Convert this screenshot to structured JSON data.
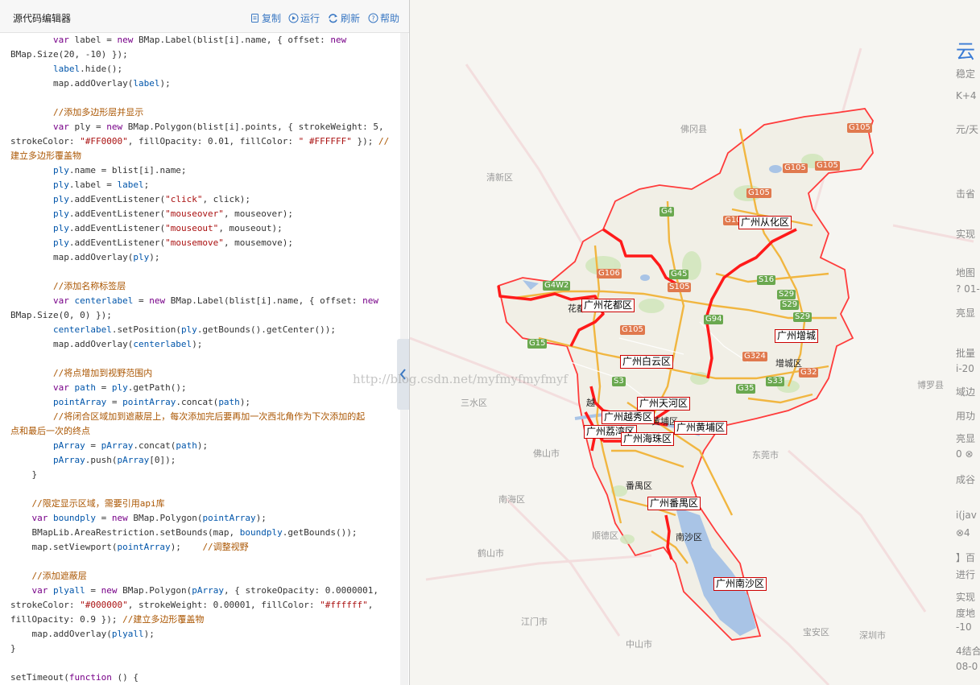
{
  "editor": {
    "title": "源代码编辑器",
    "toolbar": {
      "copy": "复制",
      "run": "运行",
      "refresh": "刷新",
      "help": "帮助"
    },
    "code_lines": [
      [
        [
          "w",
          "        "
        ],
        [
          "kw",
          "var "
        ],
        [
          "w",
          "label = "
        ],
        [
          "kw",
          "new "
        ],
        [
          "w",
          "BMap.Label(blist[i].name, { offset: "
        ],
        [
          "kw",
          "new"
        ]
      ],
      [
        [
          "w",
          "BMap.Size(20, -10) });"
        ]
      ],
      [
        [
          "w",
          "        "
        ],
        [
          "fn",
          "label"
        ],
        [
          "w",
          ".hide();"
        ]
      ],
      [
        [
          "w",
          "        map.addOverlay("
        ],
        [
          "fn",
          "label"
        ],
        [
          "w",
          ");"
        ]
      ],
      [
        [
          "w",
          ""
        ]
      ],
      [
        [
          "w",
          "        "
        ],
        [
          "cm",
          "//添加多边形层并显示"
        ]
      ],
      [
        [
          "w",
          "        "
        ],
        [
          "kw",
          "var "
        ],
        [
          "w",
          "ply = "
        ],
        [
          "kw",
          "new "
        ],
        [
          "w",
          "BMap.Polygon(blist[i].points, { strokeWeight: 5,"
        ]
      ],
      [
        [
          "w",
          "strokeColor: "
        ],
        [
          "str",
          "\"#FF0000\""
        ],
        [
          "w",
          ", fillOpacity: 0.01, fillColor: "
        ],
        [
          "str",
          "\" #FFFFFF\""
        ],
        [
          "w",
          " }); "
        ],
        [
          "cm",
          "//"
        ]
      ],
      [
        [
          "cm",
          "建立多边形覆盖物"
        ]
      ],
      [
        [
          "w",
          "        "
        ],
        [
          "fn",
          "ply"
        ],
        [
          "w",
          ".name = blist[i].name;"
        ]
      ],
      [
        [
          "w",
          "        "
        ],
        [
          "fn",
          "ply"
        ],
        [
          "w",
          ".label = "
        ],
        [
          "fn",
          "label"
        ],
        [
          "w",
          ";"
        ]
      ],
      [
        [
          "w",
          "        "
        ],
        [
          "fn",
          "ply"
        ],
        [
          "w",
          ".addEventListener("
        ],
        [
          "str",
          "\"click\""
        ],
        [
          "w",
          ", click);"
        ]
      ],
      [
        [
          "w",
          "        "
        ],
        [
          "fn",
          "ply"
        ],
        [
          "w",
          ".addEventListener("
        ],
        [
          "str",
          "\"mouseover\""
        ],
        [
          "w",
          ", mouseover);"
        ]
      ],
      [
        [
          "w",
          "        "
        ],
        [
          "fn",
          "ply"
        ],
        [
          "w",
          ".addEventListener("
        ],
        [
          "str",
          "\"mouseout\""
        ],
        [
          "w",
          ", mouseout);"
        ]
      ],
      [
        [
          "w",
          "        "
        ],
        [
          "fn",
          "ply"
        ],
        [
          "w",
          ".addEventListener("
        ],
        [
          "str",
          "\"mousemove\""
        ],
        [
          "w",
          ", mousemove);"
        ]
      ],
      [
        [
          "w",
          "        map.addOverlay("
        ],
        [
          "fn",
          "ply"
        ],
        [
          "w",
          ");"
        ]
      ],
      [
        [
          "w",
          ""
        ]
      ],
      [
        [
          "w",
          "        "
        ],
        [
          "cm",
          "//添加名称标签层"
        ]
      ],
      [
        [
          "w",
          "        "
        ],
        [
          "kw",
          "var "
        ],
        [
          "fn",
          "centerlabel"
        ],
        [
          "w",
          " = "
        ],
        [
          "kw",
          "new "
        ],
        [
          "w",
          "BMap.Label(blist[i].name, { offset: "
        ],
        [
          "kw",
          "new"
        ]
      ],
      [
        [
          "w",
          "BMap.Size(0, 0) });"
        ]
      ],
      [
        [
          "w",
          "        "
        ],
        [
          "fn",
          "centerlabel"
        ],
        [
          "w",
          ".setPosition("
        ],
        [
          "fn",
          "ply"
        ],
        [
          "w",
          ".getBounds().getCenter());"
        ]
      ],
      [
        [
          "w",
          "        map.addOverlay("
        ],
        [
          "fn",
          "centerlabel"
        ],
        [
          "w",
          ");"
        ]
      ],
      [
        [
          "w",
          ""
        ]
      ],
      [
        [
          "w",
          "        "
        ],
        [
          "cm",
          "//将点增加到视野范围内"
        ]
      ],
      [
        [
          "w",
          "        "
        ],
        [
          "kw",
          "var "
        ],
        [
          "fn",
          "path"
        ],
        [
          "w",
          " = "
        ],
        [
          "fn",
          "ply"
        ],
        [
          "w",
          ".getPath();"
        ]
      ],
      [
        [
          "w",
          "        "
        ],
        [
          "fn",
          "pointArray"
        ],
        [
          "w",
          " = "
        ],
        [
          "fn",
          "pointArray"
        ],
        [
          "w",
          ".concat("
        ],
        [
          "fn",
          "path"
        ],
        [
          "w",
          ");"
        ]
      ],
      [
        [
          "w",
          "        "
        ],
        [
          "cm",
          "//将闭合区域加到遮蔽层上，每次添加完后要再加一次西北角作为下次添加的起"
        ]
      ],
      [
        [
          "cm",
          "点和最后一次的终点"
        ]
      ],
      [
        [
          "w",
          "        "
        ],
        [
          "fn",
          "pArray"
        ],
        [
          "w",
          " = "
        ],
        [
          "fn",
          "pArray"
        ],
        [
          "w",
          ".concat("
        ],
        [
          "fn",
          "path"
        ],
        [
          "w",
          ");"
        ]
      ],
      [
        [
          "w",
          "        "
        ],
        [
          "fn",
          "pArray"
        ],
        [
          "w",
          ".push("
        ],
        [
          "fn",
          "pArray"
        ],
        [
          "w",
          "[0]);"
        ]
      ],
      [
        [
          "w",
          "    }"
        ]
      ],
      [
        [
          "w",
          ""
        ]
      ],
      [
        [
          "w",
          "    "
        ],
        [
          "cm",
          "//限定显示区域，需要引用api库"
        ]
      ],
      [
        [
          "w",
          "    "
        ],
        [
          "kw",
          "var "
        ],
        [
          "fn",
          "boundply"
        ],
        [
          "w",
          " = "
        ],
        [
          "kw",
          "new "
        ],
        [
          "w",
          "BMap.Polygon("
        ],
        [
          "fn",
          "pointArray"
        ],
        [
          "w",
          ");"
        ]
      ],
      [
        [
          "w",
          "    BMapLib.AreaRestriction.setBounds(map, "
        ],
        [
          "fn",
          "boundply"
        ],
        [
          "w",
          ".getBounds());"
        ]
      ],
      [
        [
          "w",
          "    map.setViewport("
        ],
        [
          "fn",
          "pointArray"
        ],
        [
          "w",
          ");    "
        ],
        [
          "cm",
          "//调整视野"
        ]
      ],
      [
        [
          "w",
          ""
        ]
      ],
      [
        [
          "w",
          "    "
        ],
        [
          "cm",
          "//添加遮蔽层"
        ]
      ],
      [
        [
          "w",
          "    "
        ],
        [
          "kw",
          "var "
        ],
        [
          "fn",
          "plyall"
        ],
        [
          "w",
          " = "
        ],
        [
          "kw",
          "new "
        ],
        [
          "w",
          "BMap.Polygon("
        ],
        [
          "fn",
          "pArray"
        ],
        [
          "w",
          ", { strokeOpacity: 0.0000001,"
        ]
      ],
      [
        [
          "w",
          "strokeColor: "
        ],
        [
          "str",
          "\"#000000\""
        ],
        [
          "w",
          ", strokeWeight: 0.00001, fillColor: "
        ],
        [
          "str",
          "\"#ffffff\""
        ],
        [
          "w",
          ","
        ]
      ],
      [
        [
          "w",
          "fillOpacity: 0.9 }); "
        ],
        [
          "cm",
          "//建立多边形覆盖物"
        ]
      ],
      [
        [
          "w",
          "    map.addOverlay("
        ],
        [
          "fn",
          "plyall"
        ],
        [
          "w",
          ");"
        ]
      ],
      [
        [
          "w",
          "}"
        ]
      ],
      [
        [
          "w",
          ""
        ]
      ],
      [
        [
          "w",
          "setTimeout("
        ],
        [
          "kw",
          "function "
        ],
        [
          "w",
          "() {"
        ]
      ]
    ]
  },
  "map": {
    "watermark": "http://blog.csdn.net/myfmyfmyfmyf",
    "district_labels": [
      {
        "id": "conghua",
        "text": "广州从化区"
      },
      {
        "id": "huadu",
        "text": "广州花都区"
      },
      {
        "id": "zengcheng",
        "text": "广州增城"
      },
      {
        "id": "baiyun",
        "text": "广州白云区"
      },
      {
        "id": "tianhe",
        "text": "广州天河区"
      },
      {
        "id": "yuexiu",
        "text": "广州越秀区"
      },
      {
        "id": "huangpu",
        "text": "广州黄埔区"
      },
      {
        "id": "liwan",
        "text": "广州荔湾区"
      },
      {
        "id": "haizhu",
        "text": "广州海珠区"
      },
      {
        "id": "panyu",
        "text": "广州番禺区"
      },
      {
        "id": "nansha",
        "text": "广州南沙区"
      }
    ],
    "place_names": [
      {
        "id": "huadu-short",
        "text": "花都"
      },
      {
        "id": "zengcheng-qu",
        "text": "增城区"
      },
      {
        "id": "panyu-qu",
        "text": "番禺区"
      },
      {
        "id": "nansha-qu",
        "text": "南沙区"
      },
      {
        "id": "huangpu-qu",
        "text": "黄埔区"
      },
      {
        "id": "yuexiu-short",
        "text": "越"
      }
    ],
    "faint_places": [
      {
        "id": "foshan",
        "text": "佛山市"
      },
      {
        "id": "dongguan",
        "text": "东莞市"
      },
      {
        "id": "jiangmen",
        "text": "江门市"
      },
      {
        "id": "zhongshan",
        "text": "中山市"
      },
      {
        "id": "shenzhen",
        "text": "深圳市"
      },
      {
        "id": "sanshui",
        "text": "三水区"
      },
      {
        "id": "nanhai",
        "text": "南海区"
      },
      {
        "id": "shunde",
        "text": "顺德区"
      },
      {
        "id": "heshan",
        "text": "鹤山市"
      },
      {
        "id": "qingxin",
        "text": "清新区"
      },
      {
        "id": "fogang",
        "text": "佛冈县"
      },
      {
        "id": "baoan",
        "text": "宝安区"
      },
      {
        "id": "boluo",
        "text": "博罗县"
      }
    ],
    "road_shields": [
      {
        "id": "g105a",
        "text": "G105",
        "kind": "g"
      },
      {
        "id": "g105b",
        "text": "G105",
        "kind": "g"
      },
      {
        "id": "g105c",
        "text": "G105",
        "kind": "g"
      },
      {
        "id": "g105d",
        "text": "G105",
        "kind": "g"
      },
      {
        "id": "g105e",
        "text": "G105",
        "kind": "g"
      },
      {
        "id": "g106",
        "text": "G106",
        "kind": "g"
      },
      {
        "id": "g106b",
        "text": "G106",
        "kind": "g"
      },
      {
        "id": "g45",
        "text": "G45",
        "kind": "s"
      },
      {
        "id": "s105",
        "text": "S105",
        "kind": "g"
      },
      {
        "id": "g4w2",
        "text": "G4W2",
        "kind": "s"
      },
      {
        "id": "g4",
        "text": "G4",
        "kind": "s"
      },
      {
        "id": "s16",
        "text": "S16",
        "kind": "s"
      },
      {
        "id": "s29a",
        "text": "S29",
        "kind": "s"
      },
      {
        "id": "s29b",
        "text": "S29",
        "kind": "s"
      },
      {
        "id": "s29c",
        "text": "S29",
        "kind": "s"
      },
      {
        "id": "g324",
        "text": "G324",
        "kind": "g"
      },
      {
        "id": "g35",
        "text": "G35",
        "kind": "s"
      },
      {
        "id": "g94",
        "text": "G94",
        "kind": "s"
      },
      {
        "id": "g15",
        "text": "G15",
        "kind": "s"
      },
      {
        "id": "s3",
        "text": "S3",
        "kind": "s"
      },
      {
        "id": "g32x",
        "text": "G32",
        "kind": "g"
      },
      {
        "id": "s33",
        "text": "S33",
        "kind": "s"
      }
    ]
  },
  "side_panel": {
    "texts": [
      "云",
      "稳定",
      "K+4",
      "元/天",
      "击省",
      "实现",
      "地图",
      "? 01-",
      "亮显",
      "批量",
      "i-20",
      "域边",
      "用功",
      "亮显",
      "0 ⊗",
      "成谷",
      "i(jav",
      "⊗4",
      "】百",
      "进行",
      "实现",
      "度地",
      "-10",
      "4结合",
      "08-0"
    ]
  },
  "colors": {
    "boundary": "#ff3b3b",
    "boundary_thick": "#ff1a1a",
    "road_major": "#f1b640",
    "road_minor": "#ffffff",
    "water": "#a9c4e6",
    "land_inside": "#f1efe6",
    "green": "#cfe6b8"
  }
}
